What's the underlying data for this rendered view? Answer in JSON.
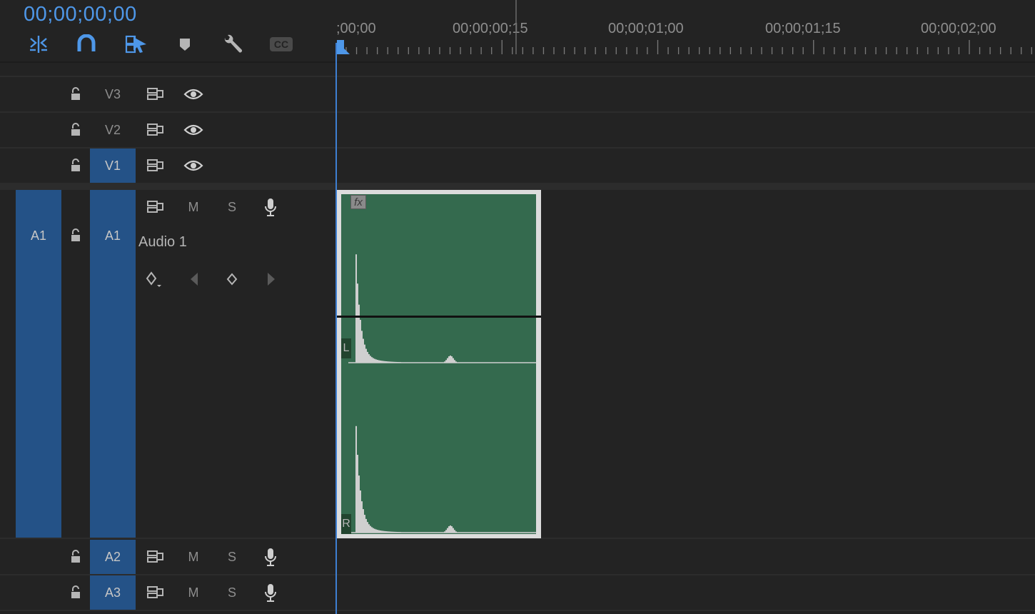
{
  "timeline": {
    "timecode": "00;00;00;00",
    "ruler_labels": [
      ";00;00",
      "00;00;00;15",
      "00;00;01;00",
      "00;00;01;15",
      "00;00;02;00"
    ]
  },
  "toolbar": {
    "tools": [
      "insert-overwrite-icon",
      "snap-magnet-icon",
      "linked-selection-icon",
      "add-marker-icon",
      "wrench-settings-icon",
      "closed-captions-icon"
    ],
    "cc_label": "CC"
  },
  "tracks": {
    "video": [
      {
        "label": "V3",
        "targeted": false
      },
      {
        "label": "V2",
        "targeted": false
      },
      {
        "label": "V1",
        "targeted": true
      }
    ],
    "audio": [
      {
        "label": "A1",
        "source_label": "A1",
        "name": "Audio 1",
        "mute": "M",
        "solo": "S",
        "targeted": true
      },
      {
        "label": "A2",
        "mute": "M",
        "solo": "S",
        "targeted": true
      },
      {
        "label": "A3",
        "mute": "M",
        "solo": "S",
        "targeted": true
      }
    ]
  },
  "clip": {
    "fx_badge": "fx",
    "channel_left": "L",
    "channel_right": "R"
  },
  "colors": {
    "accent": "#4e97e8",
    "target_blue": "#245287",
    "clip_green": "#346a4e",
    "background": "#232323"
  }
}
